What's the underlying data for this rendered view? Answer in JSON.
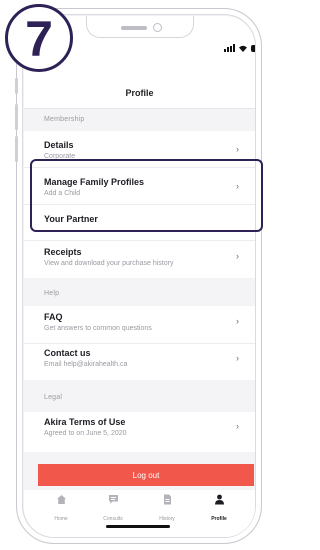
{
  "step_badge": {
    "number": "7"
  },
  "header": {
    "title": "Profile"
  },
  "sections": {
    "membership": {
      "label": "Membership"
    },
    "help": {
      "label": "Help"
    },
    "legal": {
      "label": "Legal"
    }
  },
  "rows": {
    "details": {
      "title": "Details",
      "subtitle": "Corporate",
      "chevron": "›"
    },
    "manage_family": {
      "title": "Manage Family Profiles",
      "subtitle": "Add a Child",
      "chevron": "›"
    },
    "your_partner": {
      "title": "Your Partner"
    },
    "receipts": {
      "title": "Receipts",
      "subtitle": "View and download your purchase history",
      "chevron": "›"
    },
    "faq": {
      "title": "FAQ",
      "subtitle": "Get answers to common questions",
      "chevron": "›"
    },
    "contact": {
      "title": "Contact us",
      "subtitle": "Email help@akirahealth.ca",
      "chevron": "›"
    },
    "terms": {
      "title": "Akira Terms of Use",
      "subtitle": "Agreed to on June 5, 2020",
      "chevron": "›"
    }
  },
  "logout_label": "Log out",
  "tabs": [
    {
      "label": "Home",
      "icon": "home-icon",
      "active": false
    },
    {
      "label": "Consults",
      "icon": "chat-icon",
      "active": false
    },
    {
      "label": "History",
      "icon": "document-icon",
      "active": false
    },
    {
      "label": "Profile",
      "icon": "person-icon",
      "active": true
    }
  ],
  "colors": {
    "badge": "#2e2156",
    "highlight": "#2e2156",
    "logout": "#f1584b",
    "active_tab": "#1d1d24",
    "inactive_tab": "#9a9aa2"
  }
}
